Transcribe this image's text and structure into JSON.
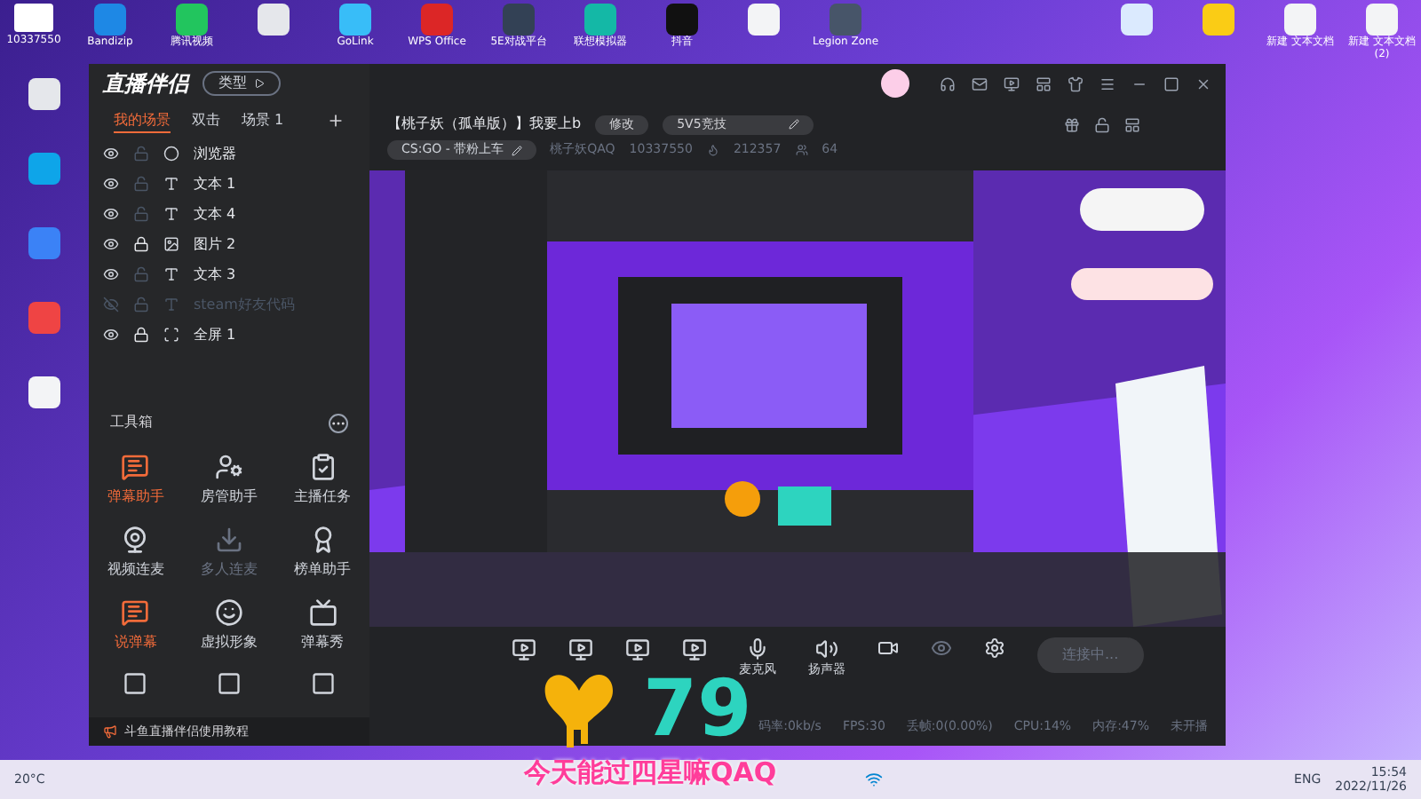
{
  "desktop_top": {
    "account": "10337550",
    "icons": [
      {
        "label": "Bandizip",
        "color": "#1e88e5"
      },
      {
        "label": "腾讯视频",
        "color": "#22c55e"
      },
      {
        "color": "#e5e7eb"
      },
      {
        "label": "GoLink",
        "color": "#38bdf8"
      },
      {
        "label": "WPS Office",
        "color": "#dc2626"
      },
      {
        "label": "5E对战平台",
        "color": "#334155"
      },
      {
        "label": "联想模拟器",
        "color": "#14b8a6"
      },
      {
        "label": "抖音",
        "color": "#111111"
      },
      {
        "color": "#f3f4f6"
      },
      {
        "label": "Legion Zone",
        "color": "#475569"
      }
    ],
    "right_icons": [
      {
        "color": "#dbeafe"
      },
      {
        "color": "#facc15"
      },
      {
        "label": "新建 文本文档",
        "color": "#f3f4f6"
      },
      {
        "label": "新建 文本文档 (2)",
        "color": "#f3f4f6"
      }
    ]
  },
  "desktop_left": {
    "icons": [
      {
        "color": "#e5e7eb"
      },
      {
        "color": "#0ea5e9"
      },
      {
        "color": "#3b82f6"
      },
      {
        "color": "#ef4444"
      },
      {
        "color": "#f3f4f6"
      }
    ]
  },
  "app": {
    "logo": "直播伴侣",
    "type_button": "类型",
    "scene_tabs": [
      {
        "label": "我的场景",
        "selected": true
      },
      {
        "label": "双击",
        "selected": false
      },
      {
        "label": "场景 1",
        "selected": false
      }
    ],
    "sources": [
      {
        "name": "浏览器",
        "kind": "browser",
        "visible": true,
        "locked": false
      },
      {
        "name": "文本 1",
        "kind": "text",
        "visible": true,
        "locked": false
      },
      {
        "name": "文本 4",
        "kind": "text",
        "visible": true,
        "locked": false
      },
      {
        "name": "图片 2",
        "visible": true,
        "locked": true
      },
      {
        "name": "文本 3",
        "kind": "text",
        "visible": true,
        "locked": false
      },
      {
        "name": "steam好友代码",
        "kind": "text",
        "visible": false,
        "locked": false
      },
      {
        "name": "全屏 1",
        "kind": "screen",
        "visible": true,
        "locked": true
      }
    ],
    "toolbox": {
      "title": "工具箱",
      "tools": [
        {
          "label": "弹幕助手",
          "kind": "chat",
          "active": true,
          "disabled": false
        },
        {
          "label": "房管助手",
          "kind": "admin",
          "active": false,
          "disabled": false
        },
        {
          "label": "主播任务",
          "kind": "task",
          "active": false,
          "disabled": false
        },
        {
          "label": "视频连麦",
          "kind": "video",
          "active": false,
          "disabled": false
        },
        {
          "label": "多人连麦",
          "kind": "download",
          "active": false,
          "disabled": true
        },
        {
          "label": "榜单助手",
          "kind": "rank",
          "active": false,
          "disabled": false
        },
        {
          "label": "说弹幕",
          "kind": "chat",
          "active": true,
          "disabled": false
        },
        {
          "label": "虚拟形象",
          "kind": "avatar",
          "active": false,
          "disabled": false
        },
        {
          "label": "弹幕秀",
          "kind": "tv",
          "active": false,
          "disabled": false
        }
      ]
    },
    "tutorial": "斗鱼直播伴侣使用教程",
    "room": {
      "title": "【桃子妖（孤单版）】我要上b",
      "edit": "修改",
      "category": "5V5竞技",
      "game": "CS:GO - 带粉上车",
      "streamer": "桃子妖QAQ",
      "room_id": "10337550",
      "heat": "212357",
      "viewers": "64"
    },
    "controls": [
      {
        "label": "麦克风",
        "kind": "mic"
      },
      {
        "label": "扬声器",
        "kind": "speaker"
      }
    ],
    "connect_button": "连接中...",
    "status": [
      "码率:0kb/s",
      "FPS:30",
      "丢帧:0(0.00%)",
      "CPU:14%",
      "内存:47%",
      "未开播"
    ]
  },
  "overlay": {
    "counter": "79",
    "caption": "今天能过四星嘛QAQ"
  },
  "taskbar": {
    "weather": "20°C",
    "language": "ENG",
    "time": "15:54",
    "date": "2022/11/26"
  }
}
